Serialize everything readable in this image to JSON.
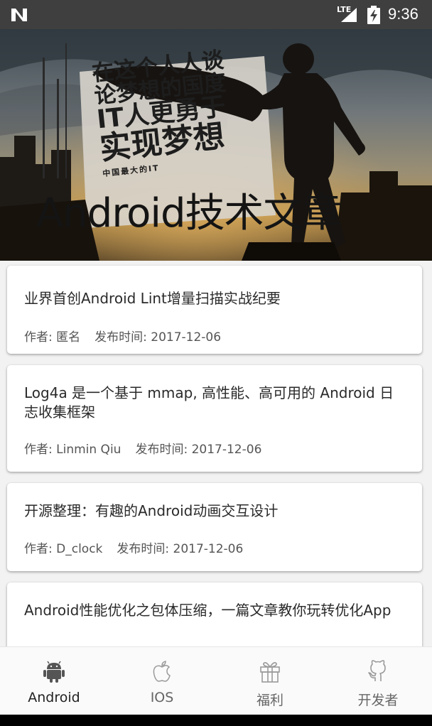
{
  "status_bar": {
    "network": "LTE",
    "time": "9:36"
  },
  "hero": {
    "poster_lines": [
      "在这个人人谈",
      "论梦想的国度",
      "IT人更勇于",
      "实现梦想",
      "中国最大的IT"
    ],
    "title": "Android技术文章"
  },
  "articles": [
    {
      "title": "业界首创Android Lint增量扫描实战纪要",
      "author_label": "作者: 匿名",
      "date_label": "发布时间: 2017-12-06"
    },
    {
      "title": "Log4a 是一个基于 mmap, 高性能、高可用的 Android 日志收集框架",
      "author_label": "作者: Linmin Qiu",
      "date_label": "发布时间: 2017-12-06"
    },
    {
      "title": "开源整理：有趣的Android动画交互设计",
      "author_label": "作者: D_clock",
      "date_label": "发布时间: 2017-12-06"
    },
    {
      "title": "Android性能优化之包体压缩，一篇文章教你玩转优化App",
      "author_label": "",
      "date_label": ""
    }
  ],
  "bottom_nav": {
    "items": [
      {
        "label": "Android",
        "icon": "android-icon",
        "active": true
      },
      {
        "label": "IOS",
        "icon": "apple-icon",
        "active": false
      },
      {
        "label": "福利",
        "icon": "gift-icon",
        "active": false
      },
      {
        "label": "开发者",
        "icon": "github-icon",
        "active": false
      }
    ]
  },
  "colors": {
    "status_bar": "#3f3f3f",
    "list_background": "#f2f2f2",
    "active_icon": "#555555",
    "inactive_icon": "#9a9a9a"
  }
}
